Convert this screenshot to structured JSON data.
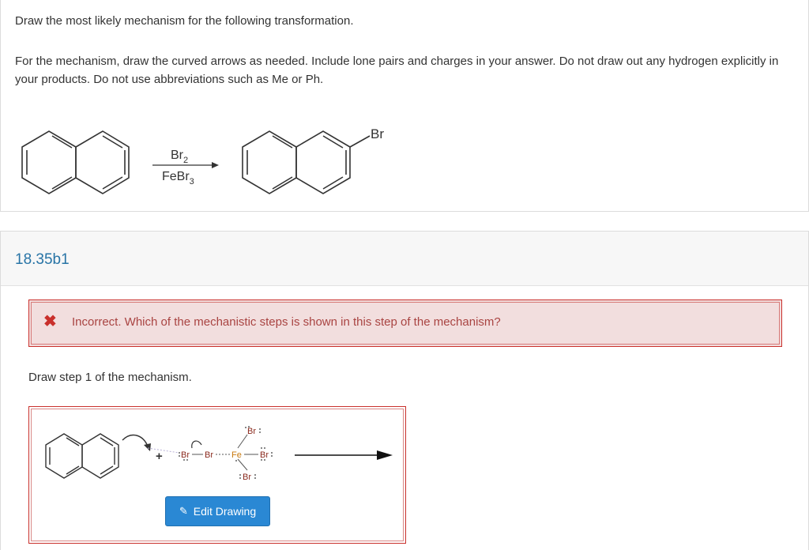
{
  "question": {
    "instruction": "Draw the most likely mechanism for the following transformation.",
    "details": "For the mechanism, draw the curved arrows as needed. Include lone pairs and charges in your answer.  Do not draw out any hydrogen explicitly in your products. Do not use abbreviations such as Me or Ph."
  },
  "reaction": {
    "reagent_top": "Br",
    "reagent_top_sub": "2",
    "reagent_bottom": "FeBr",
    "reagent_bottom_sub": "3",
    "product_substituent": "Br"
  },
  "part": {
    "id": "18.35b1",
    "feedback_icon": "x-icon",
    "feedback_text": "Incorrect. Which of the mechanistic steps is shown in this step of the mechanism?",
    "step_label": "Draw step 1 of the mechanism.",
    "edit_button_label": "Edit Drawing",
    "edit_button_icon": "pencil-icon"
  },
  "drawing": {
    "plus": "+",
    "br_left": "Br",
    "br_middle": "Br",
    "fe": "Fe",
    "br_top": "Br",
    "br_right": "Br",
    "br_bottom": "Br"
  },
  "colors": {
    "link_blue": "#2874a6",
    "error_red": "#c9302c",
    "error_bg": "#f2dede",
    "button_blue": "#2a88d4",
    "fe_color": "#c97a10",
    "br_color": "#8a2a1e"
  }
}
